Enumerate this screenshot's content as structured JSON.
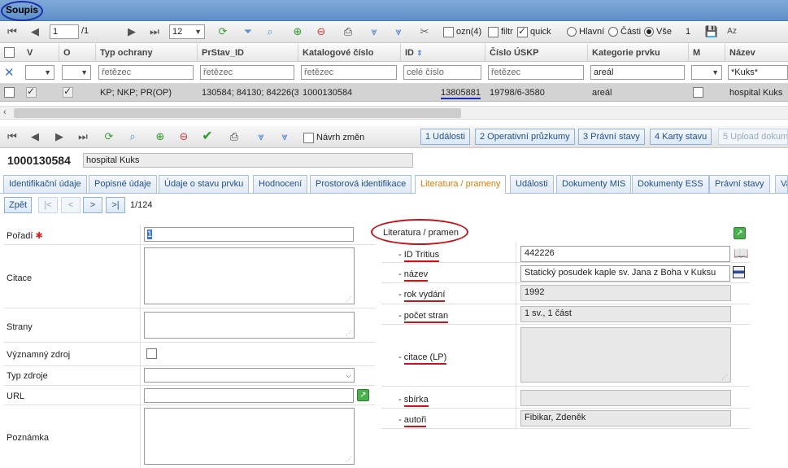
{
  "window": {
    "title": "Soupis"
  },
  "top_toolbar": {
    "page_current": "1",
    "page_total": "/1",
    "page_size": "12",
    "ozn_label": "ozn(4)",
    "filtr_label": "filtr",
    "quick_label": "quick",
    "radio_hlavni": "Hlavní",
    "radio_casti": "Části",
    "radio_vse": "Vše",
    "count": "1"
  },
  "grid": {
    "headers": [
      "V",
      "O",
      "Typ ochrany",
      "PrStav_ID",
      "Katalogové číslo",
      "ID",
      "Číslo ÚSKP",
      "Kategorie prvku",
      "M",
      "Název"
    ],
    "filters": {
      "typ_ochrany": "řetězec",
      "prstav": "řetězec",
      "katalog": "řetězec",
      "id": "celé číslo",
      "cislo_uskp": "řetězec",
      "kategorie": "areál",
      "nazev": "*Kuks*"
    },
    "row": {
      "typ_ochrany": "KP; NKP; PR(OP)",
      "prstav": "130584; 84130; 84226(3",
      "katalog": "1000130584",
      "id": "13805881",
      "cislo_uskp": "19798/6-3580",
      "kategorie": "areál",
      "nazev": "hospital Kuks"
    }
  },
  "detail_toolbar": {
    "navrh_label": "Návrh změn",
    "buttons": [
      "1 Události",
      "2 Operativní průzkumy",
      "3 Právní stavy",
      "4 Karty stavu",
      "5 Upload dokume"
    ]
  },
  "record": {
    "number": "1000130584",
    "name": "hospital Kuks"
  },
  "tabs": [
    "Identifikační údaje",
    "Popisné údaje",
    "Údaje o stavu prvku",
    "Hodnocení",
    "Prostorová identifikace",
    "Literatura / prameny",
    "Události",
    "Dokumenty MIS",
    "Dokumenty ESS",
    "Právní stavy",
    "Va"
  ],
  "pager": {
    "back": "Zpět",
    "first": "|<",
    "prev": "<",
    "next": ">",
    "last": ">|",
    "position": "1/124"
  },
  "form": {
    "poradi_label": "Pořadí",
    "poradi_value": "1",
    "citace_label": "Citace",
    "strany_label": "Strany",
    "vyznamny_label": "Významný zdroj",
    "typ_zdroje_label": "Typ zdroje",
    "url_label": "URL",
    "poznamka_label": "Poznámka"
  },
  "literatura": {
    "header": "Literatura / pramen",
    "id_tritius_label": "ID Tritius",
    "id_tritius_value": "442226",
    "nazev_label": "název",
    "nazev_value": "Statický posudek kaple sv. Jana z Boha v Kuksu",
    "rok_label": "rok vydání",
    "rok_value": "1992",
    "pocet_label": "počet stran",
    "pocet_value": "1 sv., 1 část",
    "citace_label": "citace (LP)",
    "sbirka_label": "sbírka",
    "autori_label": "autoři",
    "autori_value": "Fibikar, Zdeněk",
    "dash": "-"
  },
  "colors": {
    "accent_blue": "#1d2fa8",
    "annotation_red": "#c4141b",
    "active_tab": "#e07b00"
  }
}
